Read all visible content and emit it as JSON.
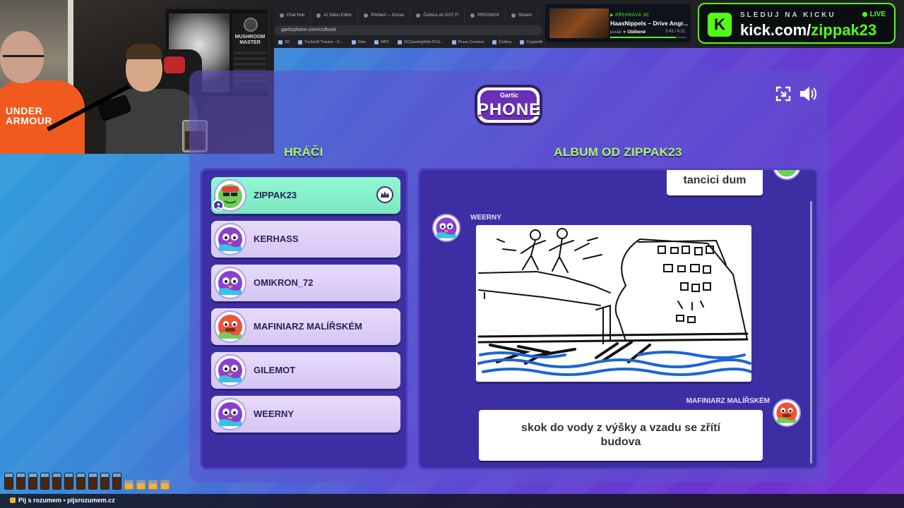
{
  "browser": {
    "tabs": [
      "Chat Hub",
      "AI Video Editor",
      "Přehled — Kozan",
      "Čeština do GOT Fi",
      "PROXMOX",
      "Stream"
    ],
    "url": "garticphone.com/cs/book",
    "bookmarks": [
      "3D",
      "TroZzoR Tracker - D...",
      "Dům",
      "MPC",
      "PCGamingWiki PCG...",
      "Pruso Connect",
      "Češtiny",
      "Crypto/AI"
    ]
  },
  "webcam": {
    "monitor_text": "MUSHROOM MASTER",
    "shirt_text": "UNDER ARMOUR"
  },
  "now_playing": {
    "label": "PŘEHRÁVÁ SE",
    "title": "HaasNippels – Drive Angr...",
    "by_prefix": "posiál",
    "by_tag": "Oblíbené",
    "time": "3:43 / 4:21",
    "progress": 0.86
  },
  "kick": {
    "top_text": "SLEDUJ NA KICKU",
    "live": "LIVE",
    "url_prefix": "kick.com/",
    "url_channel": "zippak23",
    "logo_letter": "K"
  },
  "game": {
    "logo_small": "Gartic",
    "logo_big": "PHONE",
    "players_title": "HRÁČI",
    "album_title": "ALBUM OD ZIPPAK23",
    "players": [
      {
        "name": "ZIPPAK23",
        "owner": true
      },
      {
        "name": "KERHASS",
        "owner": false
      },
      {
        "name": "OMIKRON_72",
        "owner": false
      },
      {
        "name": "MAFINIARZ MALÍŘSKÉM",
        "owner": false
      },
      {
        "name": "GILEMOT",
        "owner": false
      },
      {
        "name": "WEERNY",
        "owner": false
      }
    ],
    "album": {
      "top_bubble": "tancici dum",
      "drawing_author": "WEERNY",
      "reply_author": "MAFINIARZ MALÍŘSKÉM",
      "reply_text": "skok do vody z výšky a vzadu se zřítí budova"
    }
  },
  "overlay": {
    "bottom_text": "Pij s rozumem • pijsrozumem.cz",
    "full_glasses": 10,
    "empty_glasses": 4
  },
  "colors": {
    "kick_green": "#53fc18",
    "title_green": "#a6f36c",
    "panel": "#3d2fa3"
  }
}
